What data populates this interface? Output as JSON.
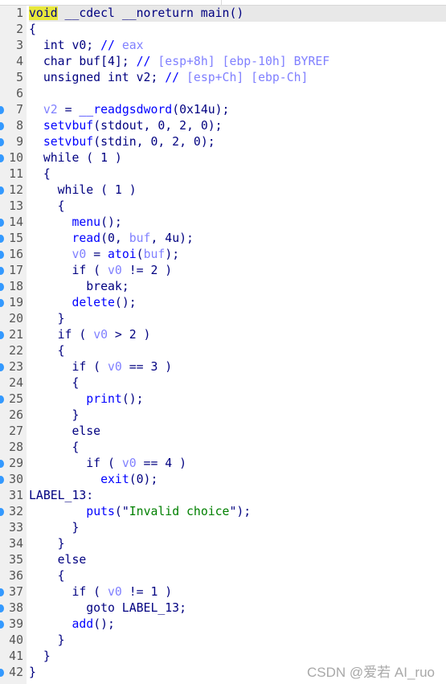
{
  "colors": {
    "keyword": "#000080",
    "function": "#0000ff",
    "variable": "#8080ff",
    "comment": "#0000ff",
    "comment_text": "#8080ff",
    "string": "#008000",
    "highlight": "#e8e83a",
    "breakpoint_dot": "#3399ff"
  },
  "current_line": 1,
  "watermark": "CSDN @爱若 AI_ruo",
  "lines": [
    {
      "n": "1",
      "dot": false,
      "t": [
        [
          "void",
          "hl"
        ],
        [
          " __cdecl __noreturn main()",
          "k"
        ]
      ]
    },
    {
      "n": "2",
      "dot": false,
      "t": [
        [
          "{",
          "k"
        ]
      ]
    },
    {
      "n": "3",
      "dot": false,
      "t": [
        [
          "  int v0; ",
          "k"
        ],
        [
          "// ",
          "c"
        ],
        [
          "eax",
          "ct"
        ]
      ]
    },
    {
      "n": "4",
      "dot": false,
      "t": [
        [
          "  char buf[4]; ",
          "k"
        ],
        [
          "// ",
          "c"
        ],
        [
          "[esp+8h] [ebp-10h] BYREF",
          "ct"
        ]
      ]
    },
    {
      "n": "5",
      "dot": false,
      "t": [
        [
          "  unsigned int v2; ",
          "k"
        ],
        [
          "// ",
          "c"
        ],
        [
          "[esp+Ch] [ebp-Ch]",
          "ct"
        ]
      ]
    },
    {
      "n": "6",
      "dot": false,
      "t": []
    },
    {
      "n": "7",
      "dot": true,
      "t": [
        [
          "  ",
          "k"
        ],
        [
          "v2",
          "v"
        ],
        [
          " = ",
          "k"
        ],
        [
          "__readgsdword",
          "f"
        ],
        [
          "(0x14u);",
          "k"
        ]
      ]
    },
    {
      "n": "8",
      "dot": true,
      "t": [
        [
          "  ",
          "k"
        ],
        [
          "setvbuf",
          "f"
        ],
        [
          "(stdout, 0, 2, 0);",
          "k"
        ]
      ]
    },
    {
      "n": "9",
      "dot": true,
      "t": [
        [
          "  ",
          "k"
        ],
        [
          "setvbuf",
          "f"
        ],
        [
          "(stdin, 0, 2, 0);",
          "k"
        ]
      ]
    },
    {
      "n": "10",
      "dot": true,
      "t": [
        [
          "  while ( 1 )",
          "k"
        ]
      ]
    },
    {
      "n": "11",
      "dot": false,
      "t": [
        [
          "  {",
          "k"
        ]
      ]
    },
    {
      "n": "12",
      "dot": true,
      "t": [
        [
          "    while ( 1 )",
          "k"
        ]
      ]
    },
    {
      "n": "13",
      "dot": false,
      "t": [
        [
          "    {",
          "k"
        ]
      ]
    },
    {
      "n": "14",
      "dot": true,
      "t": [
        [
          "      ",
          "k"
        ],
        [
          "menu",
          "f"
        ],
        [
          "();",
          "k"
        ]
      ]
    },
    {
      "n": "15",
      "dot": true,
      "t": [
        [
          "      ",
          "k"
        ],
        [
          "read",
          "f"
        ],
        [
          "(0, ",
          "k"
        ],
        [
          "buf",
          "v"
        ],
        [
          ", 4u);",
          "k"
        ]
      ]
    },
    {
      "n": "16",
      "dot": true,
      "t": [
        [
          "      ",
          "k"
        ],
        [
          "v0",
          "v"
        ],
        [
          " = ",
          "k"
        ],
        [
          "atoi",
          "f"
        ],
        [
          "(",
          "k"
        ],
        [
          "buf",
          "v"
        ],
        [
          ");",
          "k"
        ]
      ]
    },
    {
      "n": "17",
      "dot": true,
      "t": [
        [
          "      if ( ",
          "k"
        ],
        [
          "v0",
          "v"
        ],
        [
          " != 2 )",
          "k"
        ]
      ]
    },
    {
      "n": "18",
      "dot": true,
      "t": [
        [
          "        break;",
          "k"
        ]
      ]
    },
    {
      "n": "19",
      "dot": true,
      "t": [
        [
          "      ",
          "k"
        ],
        [
          "delete",
          "f"
        ],
        [
          "();",
          "k"
        ]
      ]
    },
    {
      "n": "20",
      "dot": false,
      "t": [
        [
          "    }",
          "k"
        ]
      ]
    },
    {
      "n": "21",
      "dot": true,
      "t": [
        [
          "    if ( ",
          "k"
        ],
        [
          "v0",
          "v"
        ],
        [
          " > 2 )",
          "k"
        ]
      ]
    },
    {
      "n": "22",
      "dot": false,
      "t": [
        [
          "    {",
          "k"
        ]
      ]
    },
    {
      "n": "23",
      "dot": true,
      "t": [
        [
          "      if ( ",
          "k"
        ],
        [
          "v0",
          "v"
        ],
        [
          " == 3 )",
          "k"
        ]
      ]
    },
    {
      "n": "24",
      "dot": false,
      "t": [
        [
          "      {",
          "k"
        ]
      ]
    },
    {
      "n": "25",
      "dot": true,
      "t": [
        [
          "        ",
          "k"
        ],
        [
          "print",
          "f"
        ],
        [
          "();",
          "k"
        ]
      ]
    },
    {
      "n": "26",
      "dot": false,
      "t": [
        [
          "      }",
          "k"
        ]
      ]
    },
    {
      "n": "27",
      "dot": false,
      "t": [
        [
          "      else",
          "k"
        ]
      ]
    },
    {
      "n": "28",
      "dot": false,
      "t": [
        [
          "      {",
          "k"
        ]
      ]
    },
    {
      "n": "29",
      "dot": true,
      "t": [
        [
          "        if ( ",
          "k"
        ],
        [
          "v0",
          "v"
        ],
        [
          " == 4 )",
          "k"
        ]
      ]
    },
    {
      "n": "30",
      "dot": true,
      "t": [
        [
          "          ",
          "k"
        ],
        [
          "exit",
          "f"
        ],
        [
          "(0);",
          "k"
        ]
      ]
    },
    {
      "n": "31",
      "dot": false,
      "t": [
        [
          "LABEL_13:",
          "k"
        ]
      ]
    },
    {
      "n": "32",
      "dot": true,
      "t": [
        [
          "        ",
          "k"
        ],
        [
          "puts",
          "f"
        ],
        [
          "(\"",
          "k"
        ],
        [
          "Invalid choice",
          "s"
        ],
        [
          "\");",
          "k"
        ]
      ]
    },
    {
      "n": "33",
      "dot": false,
      "t": [
        [
          "      }",
          "k"
        ]
      ]
    },
    {
      "n": "34",
      "dot": false,
      "t": [
        [
          "    }",
          "k"
        ]
      ]
    },
    {
      "n": "35",
      "dot": false,
      "t": [
        [
          "    else",
          "k"
        ]
      ]
    },
    {
      "n": "36",
      "dot": false,
      "t": [
        [
          "    {",
          "k"
        ]
      ]
    },
    {
      "n": "37",
      "dot": true,
      "t": [
        [
          "      if ( ",
          "k"
        ],
        [
          "v0",
          "v"
        ],
        [
          " != 1 )",
          "k"
        ]
      ]
    },
    {
      "n": "38",
      "dot": true,
      "t": [
        [
          "        goto LABEL_13;",
          "k"
        ]
      ]
    },
    {
      "n": "39",
      "dot": true,
      "t": [
        [
          "      ",
          "k"
        ],
        [
          "add",
          "f"
        ],
        [
          "();",
          "k"
        ]
      ]
    },
    {
      "n": "40",
      "dot": false,
      "t": [
        [
          "    }",
          "k"
        ]
      ]
    },
    {
      "n": "41",
      "dot": false,
      "t": [
        [
          "  }",
          "k"
        ]
      ]
    },
    {
      "n": "42",
      "dot": true,
      "t": [
        [
          "}",
          "k"
        ]
      ]
    }
  ]
}
